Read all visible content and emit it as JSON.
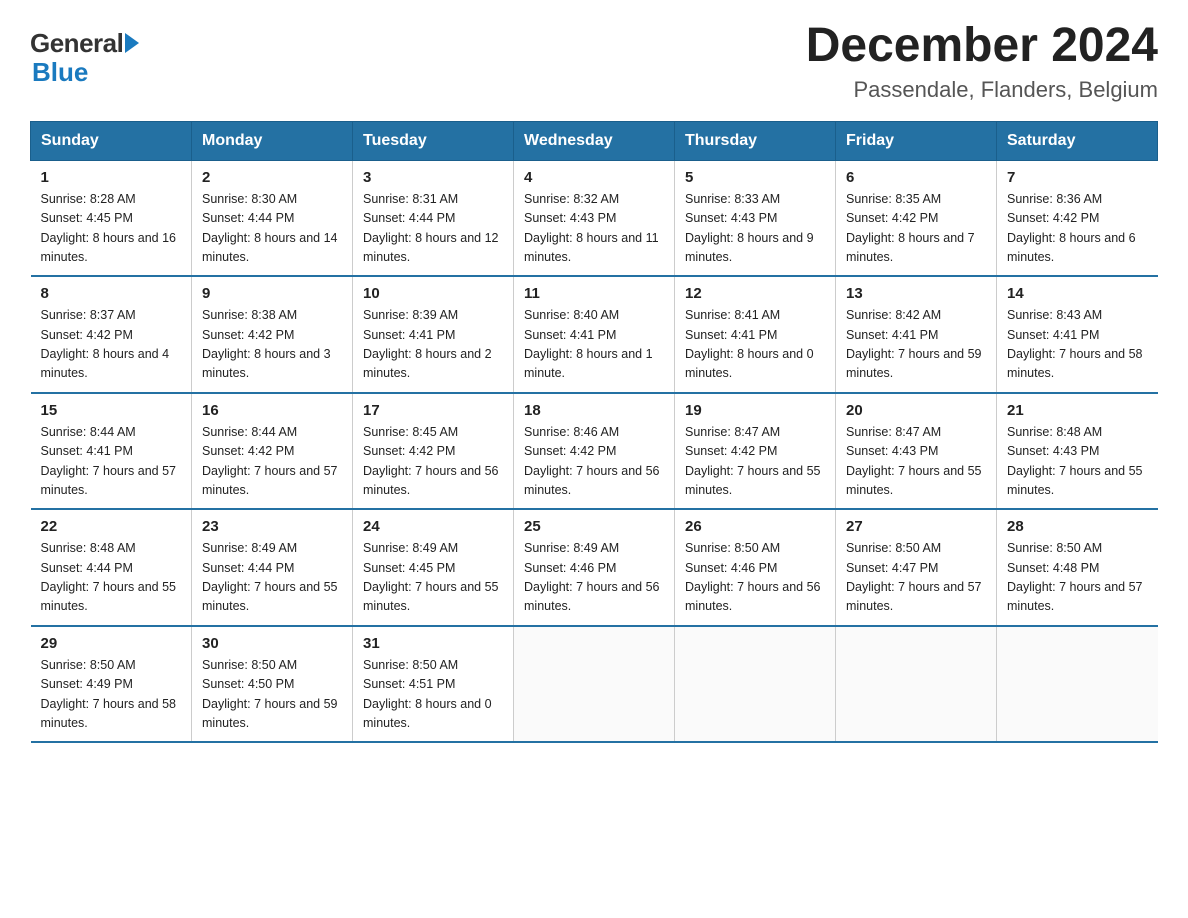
{
  "logo": {
    "general": "General",
    "blue": "Blue"
  },
  "title": "December 2024",
  "subtitle": "Passendale, Flanders, Belgium",
  "headers": [
    "Sunday",
    "Monday",
    "Tuesday",
    "Wednesday",
    "Thursday",
    "Friday",
    "Saturday"
  ],
  "weeks": [
    [
      {
        "day": "1",
        "sunrise": "8:28 AM",
        "sunset": "4:45 PM",
        "daylight": "8 hours and 16 minutes."
      },
      {
        "day": "2",
        "sunrise": "8:30 AM",
        "sunset": "4:44 PM",
        "daylight": "8 hours and 14 minutes."
      },
      {
        "day": "3",
        "sunrise": "8:31 AM",
        "sunset": "4:44 PM",
        "daylight": "8 hours and 12 minutes."
      },
      {
        "day": "4",
        "sunrise": "8:32 AM",
        "sunset": "4:43 PM",
        "daylight": "8 hours and 11 minutes."
      },
      {
        "day": "5",
        "sunrise": "8:33 AM",
        "sunset": "4:43 PM",
        "daylight": "8 hours and 9 minutes."
      },
      {
        "day": "6",
        "sunrise": "8:35 AM",
        "sunset": "4:42 PM",
        "daylight": "8 hours and 7 minutes."
      },
      {
        "day": "7",
        "sunrise": "8:36 AM",
        "sunset": "4:42 PM",
        "daylight": "8 hours and 6 minutes."
      }
    ],
    [
      {
        "day": "8",
        "sunrise": "8:37 AM",
        "sunset": "4:42 PM",
        "daylight": "8 hours and 4 minutes."
      },
      {
        "day": "9",
        "sunrise": "8:38 AM",
        "sunset": "4:42 PM",
        "daylight": "8 hours and 3 minutes."
      },
      {
        "day": "10",
        "sunrise": "8:39 AM",
        "sunset": "4:41 PM",
        "daylight": "8 hours and 2 minutes."
      },
      {
        "day": "11",
        "sunrise": "8:40 AM",
        "sunset": "4:41 PM",
        "daylight": "8 hours and 1 minute."
      },
      {
        "day": "12",
        "sunrise": "8:41 AM",
        "sunset": "4:41 PM",
        "daylight": "8 hours and 0 minutes."
      },
      {
        "day": "13",
        "sunrise": "8:42 AM",
        "sunset": "4:41 PM",
        "daylight": "7 hours and 59 minutes."
      },
      {
        "day": "14",
        "sunrise": "8:43 AM",
        "sunset": "4:41 PM",
        "daylight": "7 hours and 58 minutes."
      }
    ],
    [
      {
        "day": "15",
        "sunrise": "8:44 AM",
        "sunset": "4:41 PM",
        "daylight": "7 hours and 57 minutes."
      },
      {
        "day": "16",
        "sunrise": "8:44 AM",
        "sunset": "4:42 PM",
        "daylight": "7 hours and 57 minutes."
      },
      {
        "day": "17",
        "sunrise": "8:45 AM",
        "sunset": "4:42 PM",
        "daylight": "7 hours and 56 minutes."
      },
      {
        "day": "18",
        "sunrise": "8:46 AM",
        "sunset": "4:42 PM",
        "daylight": "7 hours and 56 minutes."
      },
      {
        "day": "19",
        "sunrise": "8:47 AM",
        "sunset": "4:42 PM",
        "daylight": "7 hours and 55 minutes."
      },
      {
        "day": "20",
        "sunrise": "8:47 AM",
        "sunset": "4:43 PM",
        "daylight": "7 hours and 55 minutes."
      },
      {
        "day": "21",
        "sunrise": "8:48 AM",
        "sunset": "4:43 PM",
        "daylight": "7 hours and 55 minutes."
      }
    ],
    [
      {
        "day": "22",
        "sunrise": "8:48 AM",
        "sunset": "4:44 PM",
        "daylight": "7 hours and 55 minutes."
      },
      {
        "day": "23",
        "sunrise": "8:49 AM",
        "sunset": "4:44 PM",
        "daylight": "7 hours and 55 minutes."
      },
      {
        "day": "24",
        "sunrise": "8:49 AM",
        "sunset": "4:45 PM",
        "daylight": "7 hours and 55 minutes."
      },
      {
        "day": "25",
        "sunrise": "8:49 AM",
        "sunset": "4:46 PM",
        "daylight": "7 hours and 56 minutes."
      },
      {
        "day": "26",
        "sunrise": "8:50 AM",
        "sunset": "4:46 PM",
        "daylight": "7 hours and 56 minutes."
      },
      {
        "day": "27",
        "sunrise": "8:50 AM",
        "sunset": "4:47 PM",
        "daylight": "7 hours and 57 minutes."
      },
      {
        "day": "28",
        "sunrise": "8:50 AM",
        "sunset": "4:48 PM",
        "daylight": "7 hours and 57 minutes."
      }
    ],
    [
      {
        "day": "29",
        "sunrise": "8:50 AM",
        "sunset": "4:49 PM",
        "daylight": "7 hours and 58 minutes."
      },
      {
        "day": "30",
        "sunrise": "8:50 AM",
        "sunset": "4:50 PM",
        "daylight": "7 hours and 59 minutes."
      },
      {
        "day": "31",
        "sunrise": "8:50 AM",
        "sunset": "4:51 PM",
        "daylight": "8 hours and 0 minutes."
      },
      null,
      null,
      null,
      null
    ]
  ]
}
